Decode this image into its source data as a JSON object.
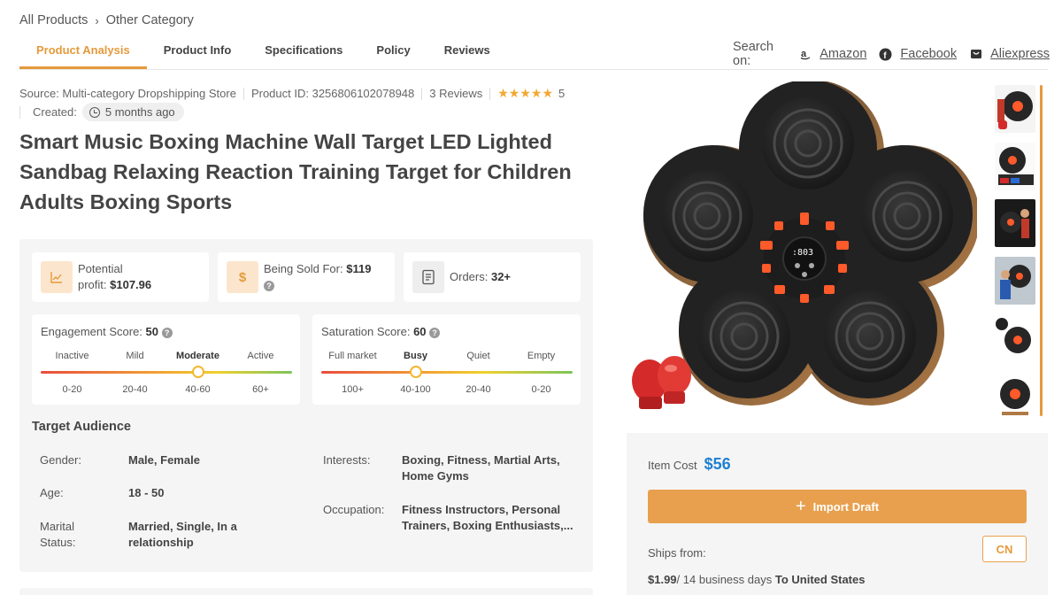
{
  "breadcrumb": {
    "root": "All Products",
    "current": "Other Category"
  },
  "tabs": [
    {
      "label": "Product Analysis",
      "active": true
    },
    {
      "label": "Product Info"
    },
    {
      "label": "Specifications"
    },
    {
      "label": "Policy"
    },
    {
      "label": "Reviews"
    }
  ],
  "search_on": {
    "label": "Search on:",
    "links": [
      "Amazon",
      "Facebook",
      "Aliexpress"
    ]
  },
  "meta": {
    "source": "Source: Multi-category Dropshipping Store",
    "product_id": "Product ID: 3256806102078948",
    "reviews": "3 Reviews",
    "rating_stars": "★★★★★",
    "rating": "5",
    "created_label": "Created:",
    "created_value": "5 months ago"
  },
  "product_title": "Smart Music Boxing Machine Wall Target LED Lighted Sandbag Relaxing Reaction Training Target for Children Adults Boxing Sports",
  "stats": {
    "profit_label_1": "Potential",
    "profit_label_2": "profit:",
    "profit_value": "$107.96",
    "sold_label": "Being Sold For:",
    "sold_value": "$119",
    "orders_label": "Orders:",
    "orders_value": "32+",
    "dollar_glyph": "$"
  },
  "engagement": {
    "label": "Engagement Score:",
    "value": "50",
    "levels": [
      "Inactive",
      "Mild",
      "Moderate",
      "Active"
    ],
    "ranges": [
      "0-20",
      "20-40",
      "40-60",
      "60+"
    ],
    "current_index": 2,
    "fraction": 0.625
  },
  "saturation": {
    "label": "Saturation Score:",
    "value": "60",
    "levels": [
      "Full market",
      "Busy",
      "Quiet",
      "Empty"
    ],
    "ranges": [
      "100+",
      "40-100",
      "20-40",
      "0-20"
    ],
    "current_index": 1,
    "fraction": 0.375
  },
  "audience": {
    "title": "Target Audience",
    "gender_label": "Gender:",
    "gender_value": "Male, Female",
    "age_label": "Age:",
    "age_value": "18 - 50",
    "marital_label_1": "Marital",
    "marital_label_2": "Status:",
    "marital_value_1": "Married, Single, In a",
    "marital_value_2": "relationship",
    "interests_label": "Interests:",
    "interests_value_1": "Boxing, Fitness, Martial Arts,",
    "interests_value_2": "Home Gyms",
    "occupation_label": "Occupation:",
    "occupation_value_1": "Fitness Instructors, Personal",
    "occupation_value_2": "Trainers, Boxing Enthusiasts,..."
  },
  "purchase": {
    "item_cost_label": "Item Cost",
    "item_cost_value": "$56",
    "import_label": "Import Draft",
    "ships_from_label": "Ships from:",
    "ships_from_value": "CN",
    "shipping_price": "$1.99",
    "shipping_days": "/ 14 business days",
    "shipping_dest": "To United States"
  },
  "display": {
    "led_text": ":803"
  },
  "colors": {
    "accent": "#e59a3c",
    "price_blue": "#1f7fd1"
  }
}
